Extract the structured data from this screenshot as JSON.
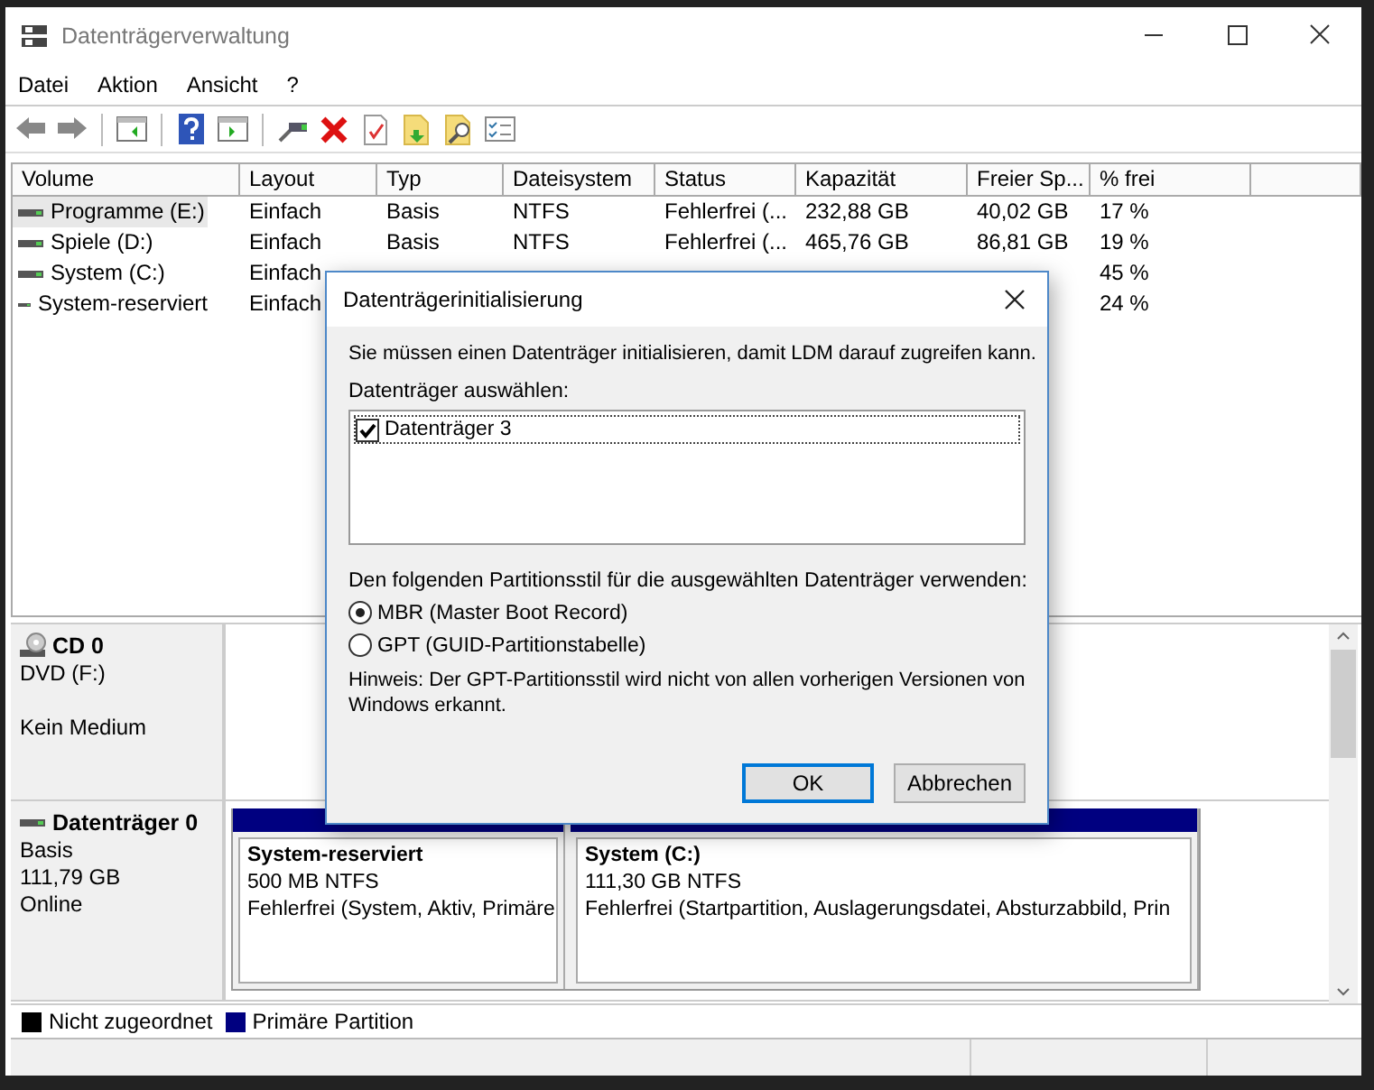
{
  "window": {
    "title": "Datenträgerverwaltung"
  },
  "menu": [
    "Datei",
    "Aktion",
    "Ansicht",
    "?"
  ],
  "volume_table": {
    "columns": [
      "Volume",
      "Layout",
      "Typ",
      "Dateisystem",
      "Status",
      "Kapazität",
      "Freier Sp...",
      "% frei"
    ],
    "rows": [
      {
        "selected": true,
        "volume": "Programme (E:)",
        "layout": "Einfach",
        "type": "Basis",
        "file_system": "NTFS",
        "status": "Fehlerfrei (...",
        "capacity": "232,88 GB",
        "free_space": "40,02 GB",
        "percent_free": "17 %"
      },
      {
        "selected": false,
        "volume": "Spiele (D:)",
        "layout": "Einfach",
        "type": "Basis",
        "file_system": "NTFS",
        "status": "Fehlerfrei (...",
        "capacity": "465,76 GB",
        "free_space": "86,81 GB",
        "percent_free": "19 %"
      },
      {
        "selected": false,
        "volume": "System (C:)",
        "layout": "Einfach",
        "percent_free": "45 %"
      },
      {
        "selected": false,
        "volume": "System-reserviert",
        "layout": "Einfach",
        "percent_free": "24 %"
      }
    ]
  },
  "disks": [
    {
      "kind": "cd",
      "name": "CD 0",
      "details": [
        "DVD (F:)"
      ],
      "status": "Kein Medium"
    },
    {
      "kind": "disk",
      "name": "Datenträger 0",
      "details": [
        "Basis",
        "111,79 GB",
        "Online"
      ],
      "partitions": [
        {
          "name": "System-reserviert",
          "size": "500 MB NTFS",
          "status": "Fehlerfrei (System, Aktiv, Primäre",
          "color": "#000080"
        },
        {
          "name": "System  (C:)",
          "size": "111,30 GB NTFS",
          "status": "Fehlerfrei (Startpartition, Auslagerungsdatei, Absturzabbild, Prin",
          "color": "#000080"
        }
      ]
    }
  ],
  "legend": [
    {
      "label": "Nicht zugeordnet",
      "color": "#000000"
    },
    {
      "label": "Primäre Partition",
      "color": "#000080"
    }
  ],
  "dialog": {
    "title": "Datenträgerinitialisierung",
    "message": "Sie müssen einen Datenträger initialisieren, damit LDM darauf zugreifen kann.",
    "list_label": "Datenträger auswählen:",
    "disks": [
      {
        "label": "Datenträger 3",
        "checked": true,
        "selected": true
      }
    ],
    "style_label": "Den folgenden Partitionsstil für die ausgewählten Datenträger verwenden:",
    "styles": [
      {
        "label": "MBR (Master Boot Record)",
        "selected": true
      },
      {
        "label": "GPT (GUID-Partitionstabelle)",
        "selected": false
      }
    ],
    "note": "Hinweis: Der GPT-Partitionsstil wird nicht von allen vorherigen Versionen von Windows erkannt.",
    "buttons": [
      {
        "label": "OK",
        "default": true
      },
      {
        "label": "Abbrechen",
        "default": false
      }
    ]
  }
}
